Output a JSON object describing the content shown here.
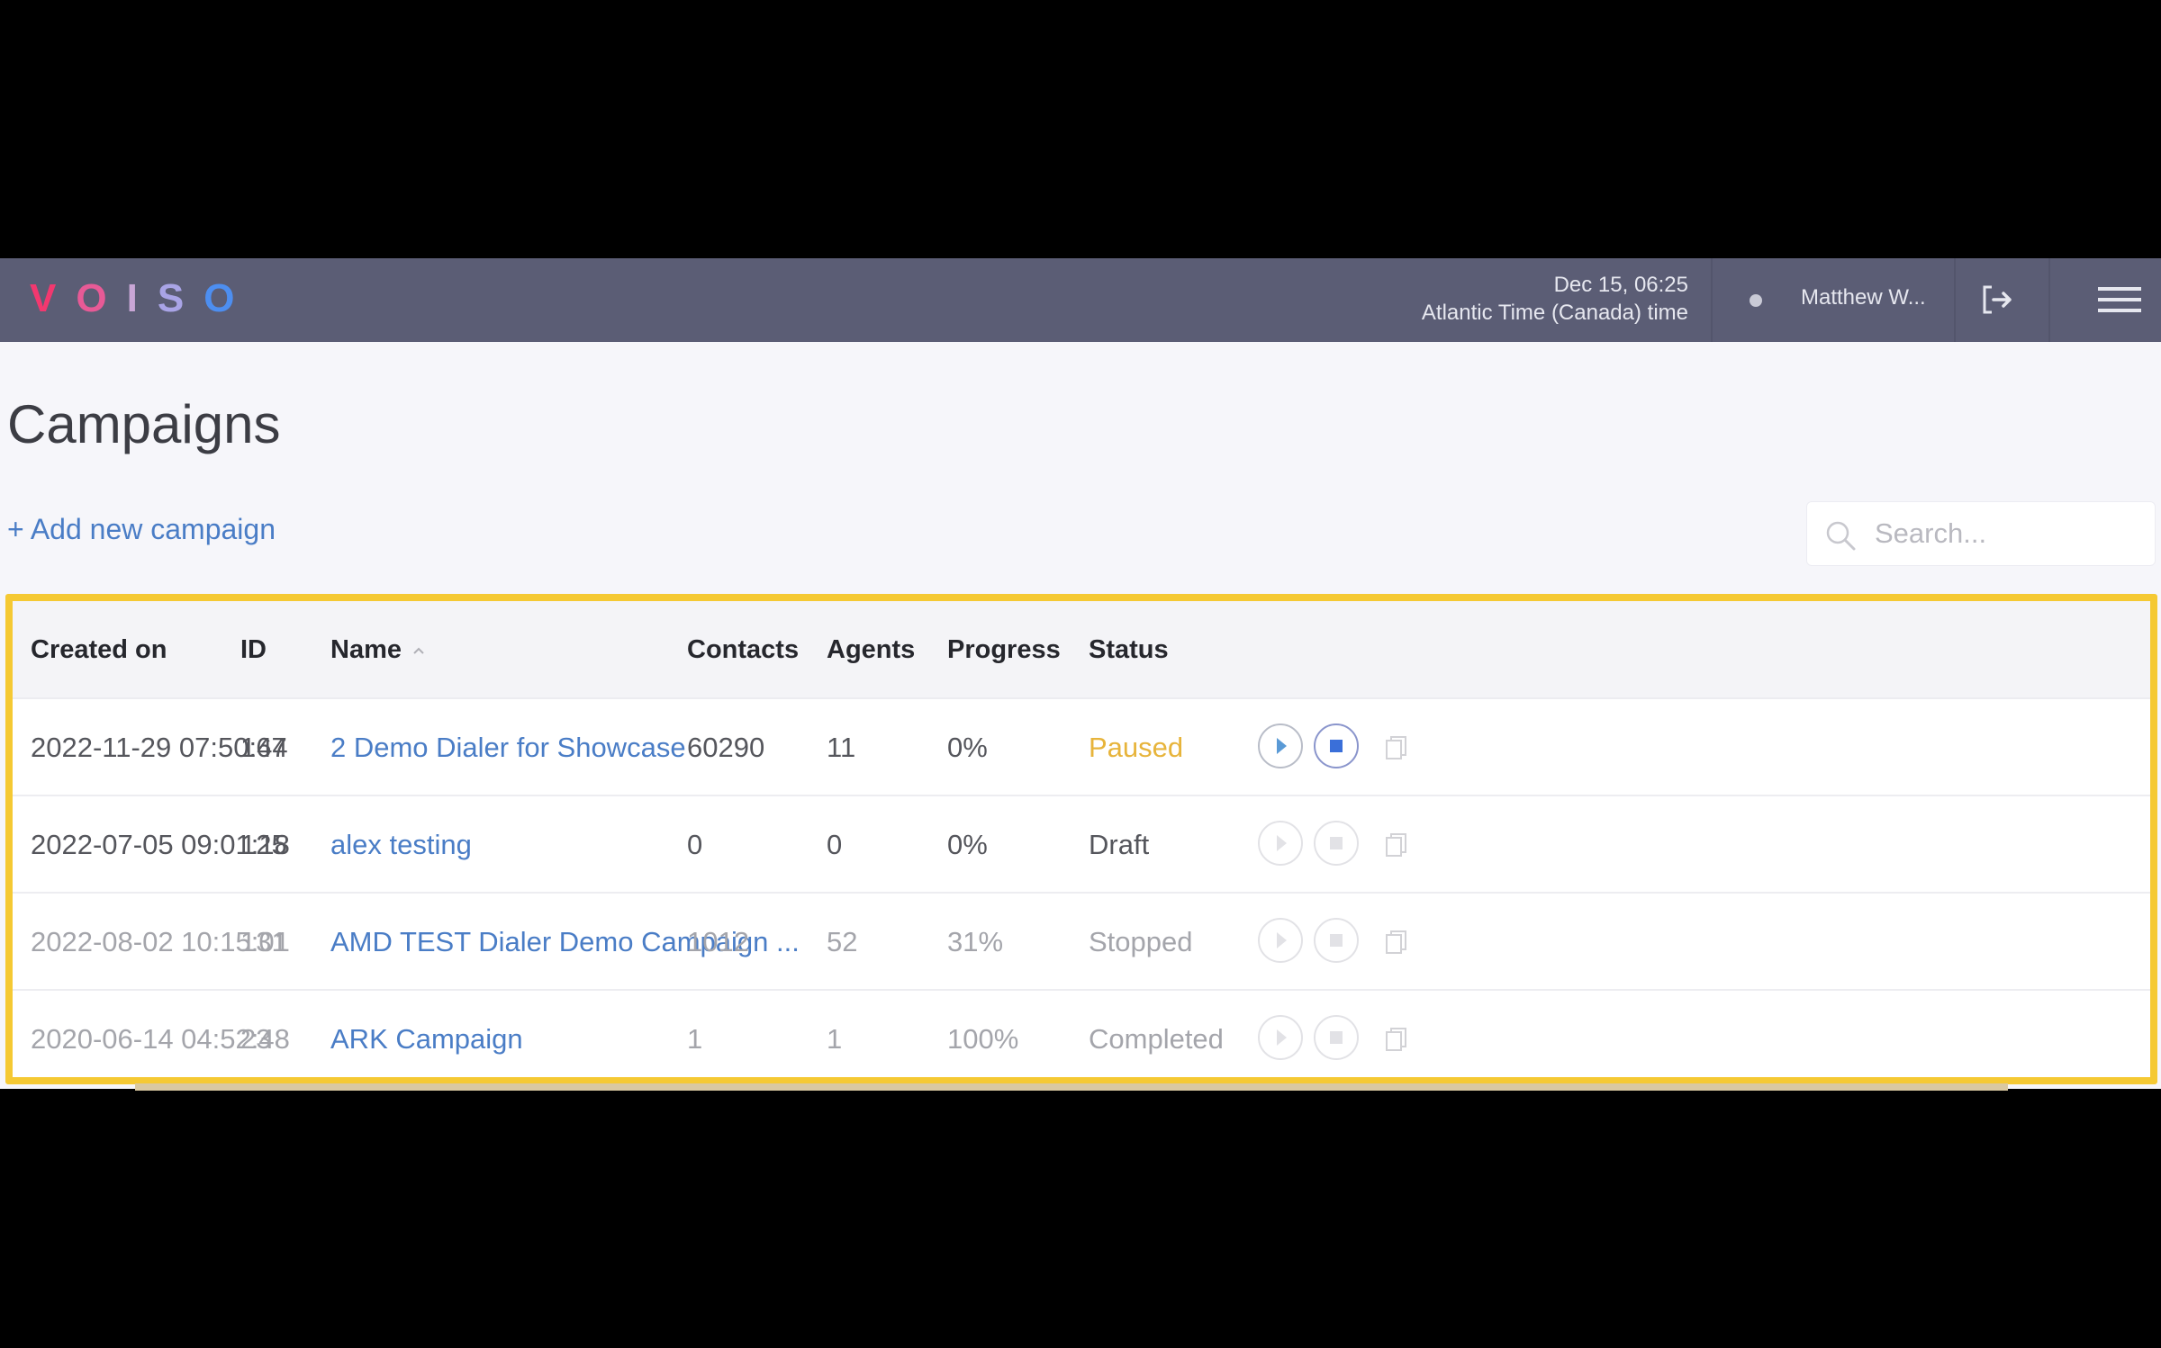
{
  "header": {
    "logo_letters": [
      {
        "char": "V",
        "color": "#f2386f"
      },
      {
        "char": "O",
        "color": "#e75a96"
      },
      {
        "char": "I",
        "color": "#c9a6d6"
      },
      {
        "char": "S",
        "color": "#a9a4e6"
      },
      {
        "char": "O",
        "color": "#4d8ef0"
      }
    ],
    "date": "Dec 15, 06:25",
    "timezone": "Atlantic Time (Canada) time",
    "username": "Matthew W...",
    "logout_icon": "logout-icon",
    "menu_icon": "hamburger-menu-icon"
  },
  "page": {
    "title": "Campaigns",
    "add_campaign_label": "+ Add new campaign",
    "search_placeholder": "Search..."
  },
  "table": {
    "columns": [
      {
        "label": "Created on"
      },
      {
        "label": "ID"
      },
      {
        "label": "Name",
        "sorted": "ascending"
      },
      {
        "label": "Contacts"
      },
      {
        "label": "Agents"
      },
      {
        "label": "Progress"
      },
      {
        "label": "Status"
      }
    ],
    "rows": [
      {
        "created_on": "2022-11-29 07:50:44",
        "id": "167",
        "name": "2 Demo Dialer for Showcase",
        "contacts": "60290",
        "agents": "11",
        "progress": "0%",
        "status": "Paused",
        "controls_enabled": true
      },
      {
        "created_on": "2022-07-05 09:01:18",
        "id": "125",
        "name": "alex testing",
        "contacts": "0",
        "agents": "0",
        "progress": "0%",
        "status": "Draft",
        "controls_enabled": false
      },
      {
        "created_on": "2022-08-02 10:15:01",
        "id": "131",
        "name": "AMD TEST Dialer Demo Campaign ...",
        "contacts": "1012",
        "agents": "52",
        "progress": "31%",
        "status": "Stopped",
        "controls_enabled": false
      },
      {
        "created_on": "2020-06-14 04:52:48",
        "id": "23",
        "name": "ARK Campaign",
        "contacts": "1",
        "agents": "1",
        "progress": "100%",
        "status": "Completed",
        "controls_enabled": false
      }
    ]
  },
  "colors": {
    "topbar": "#5b5d75",
    "link": "#4a7dc6",
    "paused": "#e7b43b",
    "highlight": "#f5c933",
    "control_active": "#4a7dc6"
  }
}
